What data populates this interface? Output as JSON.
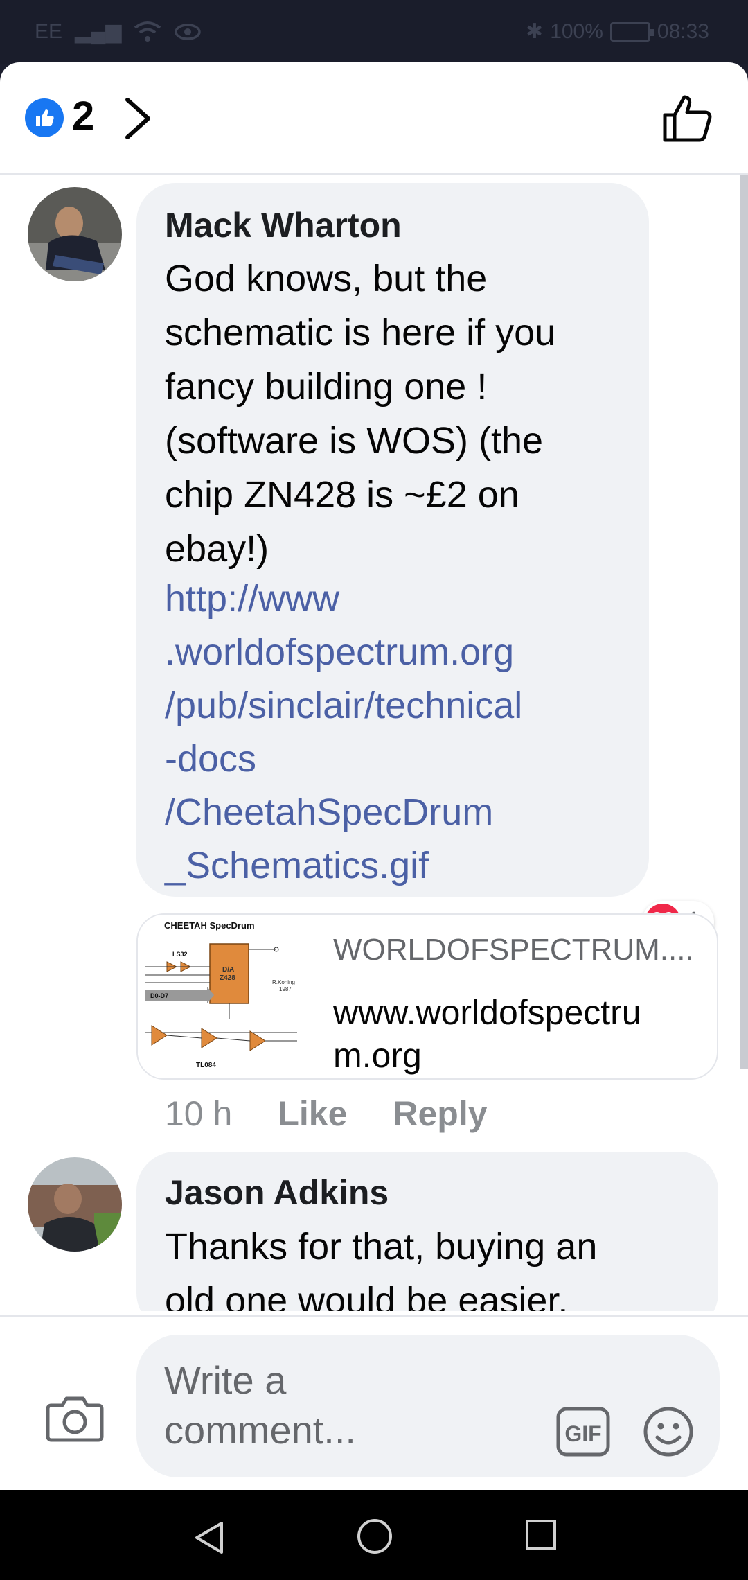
{
  "status_bar": {
    "carrier": "EE",
    "battery": "100%",
    "time": "08:33"
  },
  "header": {
    "like_count": "2"
  },
  "comments": [
    {
      "author": "Mack Wharton",
      "text": "God knows, but the\nschematic is here if you\nfancy building one !\n(software is WOS) (the\nchip ZN428 is ~£2 on\nebay!)",
      "link": "http://www\n.worldofspectrum.org\n/pub/sinclair/technical\n-docs\n/CheetahSpecDrum\n_Schematics.gif",
      "reaction_count": "1",
      "preview": {
        "domain": "WORLDOFSPECTRUM....",
        "title": "www.worldofspectru\nm.org",
        "thumb_title": "CHEETAH SpecDrum",
        "thumb_labels": [
          "LS32",
          "D/A",
          "Z428",
          "D0-D7",
          "R.Koning",
          "1987",
          "TL084"
        ]
      },
      "time": "10 h",
      "like_label": "Like",
      "reply_label": "Reply"
    },
    {
      "author": "Jason Adkins",
      "text": "Thanks for that, buying an\nold one would be easier."
    }
  ],
  "composer": {
    "placeholder": "Write a\ncomment..."
  },
  "colors": {
    "facebook_blue": "#1877f2",
    "link": "#4b60a5",
    "heart": "#f02849",
    "bubble": "#f0f2f5"
  },
  "icons": [
    "like-badge-icon",
    "chevron-right-icon",
    "thumbs-up-icon",
    "heart-icon",
    "camera-icon",
    "gif-icon",
    "emoji-icon",
    "back-icon",
    "home-icon",
    "recents-icon"
  ]
}
